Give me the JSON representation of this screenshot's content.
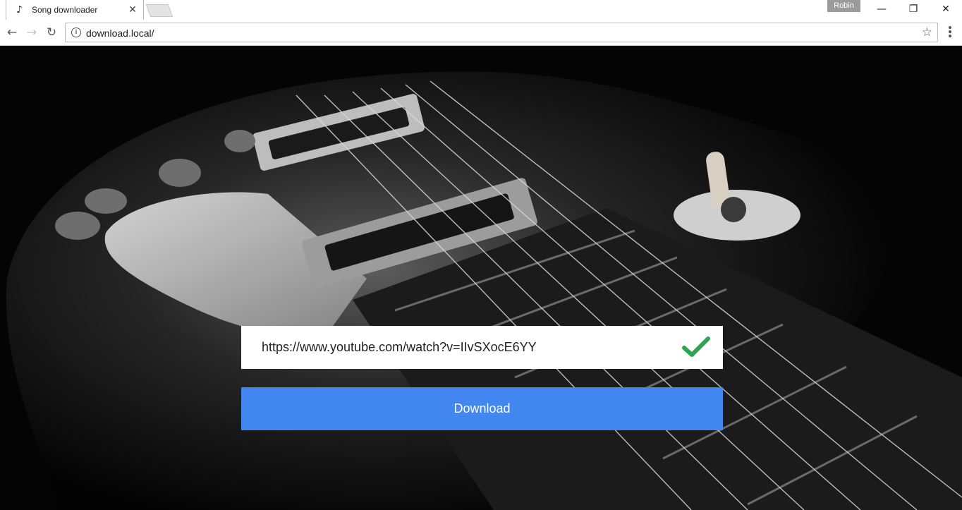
{
  "browser": {
    "tab": {
      "title": "Song downloader",
      "icon": "music-note-icon",
      "close": "✕"
    },
    "profile_name": "Robin",
    "window_controls": {
      "minimize": "—",
      "restore": "❐",
      "close": "✕"
    },
    "address_bar": {
      "url": "download.local/"
    }
  },
  "page": {
    "url_input": {
      "value": "https://www.youtube.com/watch?v=IIvSXocE6YY",
      "valid": true,
      "status_icon": "checkmark-icon"
    },
    "download_button": {
      "label": "Download"
    },
    "background": "guitar-photo"
  },
  "colors": {
    "accent": "#4286f0",
    "check": "#2ea44f"
  }
}
